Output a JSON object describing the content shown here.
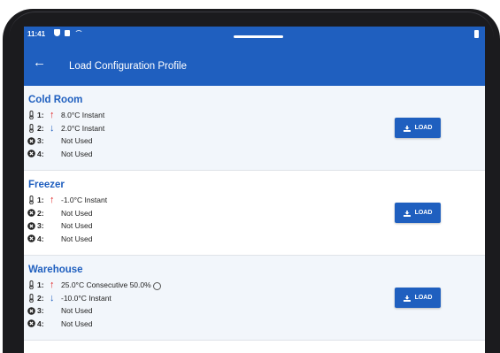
{
  "status_bar": {
    "time": "11:41"
  },
  "app_bar": {
    "title": "Load Configuration Profile"
  },
  "profiles": [
    {
      "name": "Cold Room",
      "load_label": "LOAD",
      "sensors": [
        {
          "index": "1:",
          "kind": "thermometer",
          "direction": "up",
          "reading": "8.0°C Instant",
          "clock": false
        },
        {
          "index": "2:",
          "kind": "thermometer",
          "direction": "down",
          "reading": "2.0°C Instant",
          "clock": false
        },
        {
          "index": "3:",
          "kind": "not-used",
          "direction": "",
          "reading": "Not Used",
          "clock": false
        },
        {
          "index": "4:",
          "kind": "not-used",
          "direction": "",
          "reading": "Not Used",
          "clock": false
        }
      ]
    },
    {
      "name": "Freezer",
      "load_label": "LOAD",
      "sensors": [
        {
          "index": "1:",
          "kind": "thermometer",
          "direction": "up",
          "reading": "-1.0°C Instant",
          "clock": false
        },
        {
          "index": "2:",
          "kind": "not-used",
          "direction": "",
          "reading": "Not Used",
          "clock": false
        },
        {
          "index": "3:",
          "kind": "not-used",
          "direction": "",
          "reading": "Not Used",
          "clock": false
        },
        {
          "index": "4:",
          "kind": "not-used",
          "direction": "",
          "reading": "Not Used",
          "clock": false
        }
      ]
    },
    {
      "name": "Warehouse",
      "load_label": "LOAD",
      "sensors": [
        {
          "index": "1:",
          "kind": "thermometer",
          "direction": "up",
          "reading": "25.0°C Consecutive 50.0%",
          "clock": true
        },
        {
          "index": "2:",
          "kind": "thermometer",
          "direction": "down",
          "reading": "-10.0°C Instant",
          "clock": false
        },
        {
          "index": "3:",
          "kind": "not-used",
          "direction": "",
          "reading": "Not Used",
          "clock": false
        },
        {
          "index": "4:",
          "kind": "not-used",
          "direction": "",
          "reading": "Not Used",
          "clock": false
        }
      ]
    }
  ],
  "colors": {
    "primary": "#1f5fbf",
    "alarm_up": "#e02020",
    "alarm_down": "#1f5fbf"
  }
}
